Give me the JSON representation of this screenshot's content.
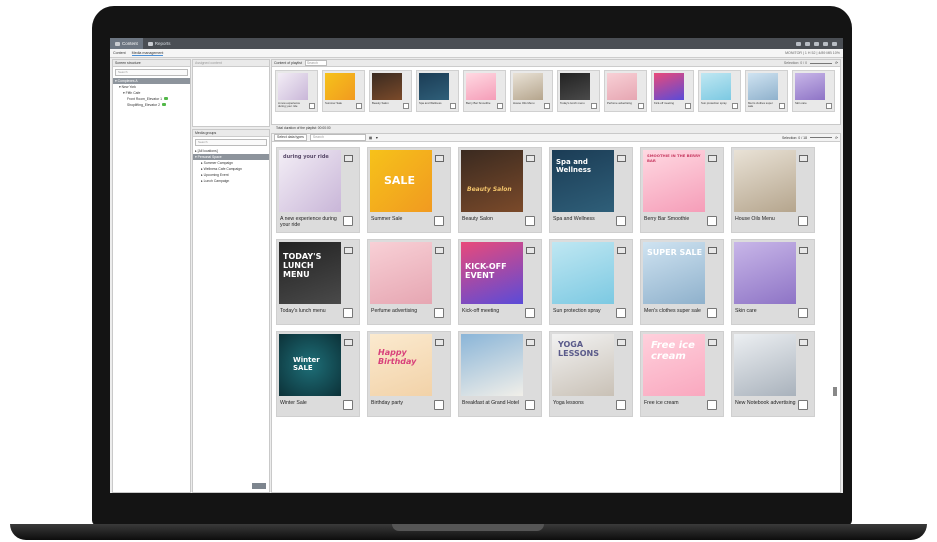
{
  "app": {
    "tabs": [
      {
        "label": "Content"
      },
      {
        "label": "Reports"
      }
    ],
    "subtabs": [
      {
        "label": "Content"
      },
      {
        "label": "Media management"
      }
    ],
    "status_right": "MONITOR | 1 H 52 | 4/89 MB 10%"
  },
  "left_panel": {
    "title": "Screen structure",
    "search_placeholder": "Search",
    "items": [
      {
        "label": "Complexes A"
      },
      {
        "label": "New York"
      },
      {
        "label": "Fifth Cafe"
      },
      {
        "label": "Front Room_Elevator 1"
      },
      {
        "label": "Shoplifting_Elevator 2"
      }
    ]
  },
  "second_panel": {
    "title": "Assigned content"
  },
  "top_panel": {
    "title": "Content of playlist",
    "search_placeholder": "Search",
    "selection": "Selection: 0 / 0",
    "items": [
      {
        "label": "A new experience during your ride"
      },
      {
        "label": "Summer Sale"
      },
      {
        "label": "Beauty Salon"
      },
      {
        "label": "Spa and Wellness"
      },
      {
        "label": "Berry Bar Smoothie"
      },
      {
        "label": "House Oils Menu"
      },
      {
        "label": "Today's lunch menu"
      },
      {
        "label": "Perfume advertising"
      },
      {
        "label": "Kick-off meeting"
      },
      {
        "label": "Sun protection spray"
      },
      {
        "label": "Men's clothes super sale"
      },
      {
        "label": "Skin care"
      }
    ],
    "total": "Total duration of the playlist: 00:00:00"
  },
  "groups_panel": {
    "title": "Media groups",
    "search_placeholder": "Search",
    "items": [
      {
        "label": "[All locations]"
      },
      {
        "label": "Personal Space"
      },
      {
        "label": "Summer Campaign"
      },
      {
        "label": "Wellness Cafe Campaign"
      },
      {
        "label": "Upcoming Event"
      },
      {
        "label": "Lunch Campaign"
      }
    ]
  },
  "media_panel": {
    "search_label": "Select data types",
    "search_placeholder": "Search",
    "selection": "Selection: 0 / 18",
    "cards": [
      {
        "label": "A new experience during your ride",
        "img_text": "during your ride"
      },
      {
        "label": "Summer Sale",
        "img_text": "SALE"
      },
      {
        "label": "Beauty Salon",
        "img_text": "Beauty Salon"
      },
      {
        "label": "Spa and Wellness",
        "img_text": "Spa and Wellness"
      },
      {
        "label": "Berry Bar Smoothie",
        "img_text": "SMOOTHIE IN THE BERRY BAR"
      },
      {
        "label": "House Oils Menu",
        "img_text": ""
      },
      {
        "label": "Today's lunch menu",
        "img_text": "TODAY'S LUNCH MENU"
      },
      {
        "label": "Perfume advertising",
        "img_text": ""
      },
      {
        "label": "Kick-off meeting",
        "img_text": "KICK-OFF EVENT"
      },
      {
        "label": "Sun protection spray",
        "img_text": ""
      },
      {
        "label": "Men's clothes super sale",
        "img_text": "SUPER SALE"
      },
      {
        "label": "Skin care",
        "img_text": ""
      },
      {
        "label": "Winter Sale",
        "img_text": "Winter SALE"
      },
      {
        "label": "Birthday party",
        "img_text": "Happy Birthday"
      },
      {
        "label": "Breakfast at Grand Hotel",
        "img_text": ""
      },
      {
        "label": "Yoga lessons",
        "img_text": "YOGA LESSONS"
      },
      {
        "label": "Free ice cream",
        "img_text": "Free ice cream"
      },
      {
        "label": "New Notebook advertising",
        "img_text": ""
      }
    ]
  }
}
